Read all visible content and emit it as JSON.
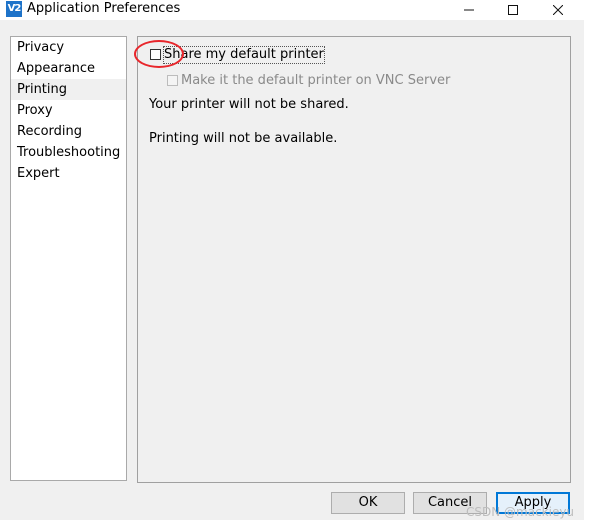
{
  "window": {
    "title": "Application Preferences",
    "app_icon_text": "V2",
    "controls": [
      "minimize",
      "maximize",
      "close"
    ]
  },
  "sidebar": {
    "items": [
      {
        "label": "Privacy",
        "selected": false
      },
      {
        "label": "Appearance",
        "selected": false
      },
      {
        "label": "Printing",
        "selected": true
      },
      {
        "label": "Proxy",
        "selected": false
      },
      {
        "label": "Recording",
        "selected": false
      },
      {
        "label": "Troubleshooting",
        "selected": false
      },
      {
        "label": "Expert",
        "selected": false
      }
    ]
  },
  "printing": {
    "share_printer": {
      "label": "Share my default printer",
      "checked": false
    },
    "make_default": {
      "label": "Make it the default printer on VNC Server",
      "checked": false,
      "enabled": false
    },
    "status_shared": "Your printer will not be shared.",
    "status_available": "Printing will not be available."
  },
  "buttons": {
    "ok": "OK",
    "cancel": "Cancel",
    "apply": "Apply"
  },
  "annotation": {
    "color": "#e8262b",
    "shape": "circle"
  },
  "watermark": "CSDN @mackieyu",
  "colors": {
    "dialog_bg": "#f0f0f0",
    "accent": "#0078d7",
    "app_icon": "#1e73c9"
  }
}
